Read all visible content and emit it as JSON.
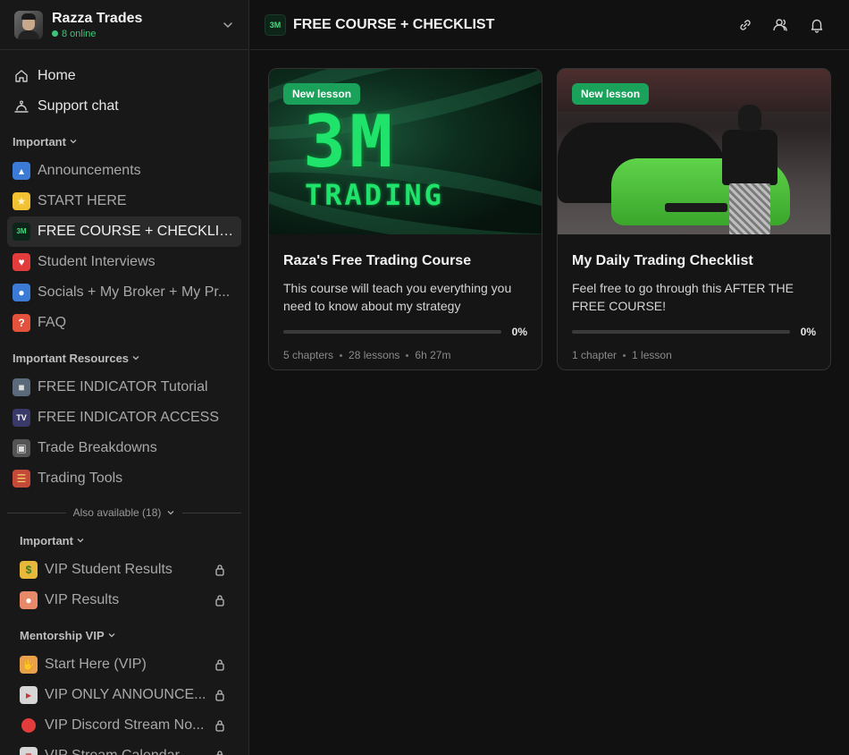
{
  "workspace": {
    "name": "Razza Trades",
    "online": "8 online"
  },
  "nav": {
    "top": [
      {
        "label": "Home",
        "icon": "home-icon"
      },
      {
        "label": "Support chat",
        "icon": "support-icon"
      }
    ],
    "sections": [
      {
        "title": "Important",
        "items": [
          {
            "label": "Announcements",
            "icon": "megaphone-icon",
            "color": "#3b7bd6"
          },
          {
            "label": "START HERE",
            "icon": "star-icon",
            "color": "#f2c233"
          },
          {
            "label": "FREE COURSE + CHECKLIST",
            "icon": "3m-logo-icon",
            "color": "#0d2418",
            "active": true
          },
          {
            "label": "Student Interviews",
            "icon": "heart-icon",
            "color": "#e23c3c"
          },
          {
            "label": "Socials + My Broker + My Pr...",
            "icon": "user-icon",
            "color": "#3b7bd6"
          },
          {
            "label": "FAQ",
            "icon": "question-icon",
            "color": "#e2523c"
          }
        ]
      },
      {
        "title": "Important Resources",
        "items": [
          {
            "label": "FREE INDICATOR Tutorial",
            "icon": "camera-icon",
            "color": "#5a6a7a"
          },
          {
            "label": "FREE INDICATOR ACCESS",
            "icon": "tradingview-icon",
            "color": "#3a3a6a"
          },
          {
            "label": "Trade Breakdowns",
            "icon": "projector-icon",
            "color": "#555"
          },
          {
            "label": "Trading Tools",
            "icon": "books-icon",
            "color": "#c64a3a"
          }
        ]
      }
    ],
    "also_available": "Also available (18)",
    "locked_sections": [
      {
        "title": "Important",
        "items": [
          {
            "label": "VIP Student Results",
            "icon": "money-face-icon",
            "color": "#e8b83a"
          },
          {
            "label": "VIP Results",
            "icon": "speech-bubble-icon",
            "color": "#e88a6a"
          }
        ]
      },
      {
        "title": "Mentorship VIP",
        "items": [
          {
            "label": "Start Here (VIP)",
            "icon": "wave-hand-icon",
            "color": "#e8a04a"
          },
          {
            "label": "VIP ONLY ANNOUNCE...",
            "icon": "loudspeaker-icon",
            "color": "#d6d6d6"
          },
          {
            "label": "VIP Discord Stream No...",
            "icon": "red-circle-icon",
            "color": "#e23c3c"
          },
          {
            "label": "VIP Stream Calendar",
            "icon": "calendar-icon",
            "color": "#d6d6d6"
          }
        ]
      }
    ]
  },
  "header": {
    "title": "FREE COURSE + CHECKLIST",
    "channel_icon_text": "3M"
  },
  "cards": [
    {
      "badge": "New lesson",
      "thumb_text_big": "3M",
      "thumb_text_small": "TRADING",
      "title": "Raza's Free Trading Course",
      "description": "This course will teach you everything you need to know about my strategy",
      "progress": 0,
      "progress_label": "0%",
      "meta": [
        "5 chapters",
        "28 lessons",
        "6h 27m"
      ]
    },
    {
      "badge": "New lesson",
      "title": "My Daily Trading Checklist",
      "description": "Feel free to go through this AFTER THE FREE COURSE!",
      "progress": 0,
      "progress_label": "0%",
      "meta": [
        "1 chapter",
        "1 lesson"
      ]
    }
  ]
}
